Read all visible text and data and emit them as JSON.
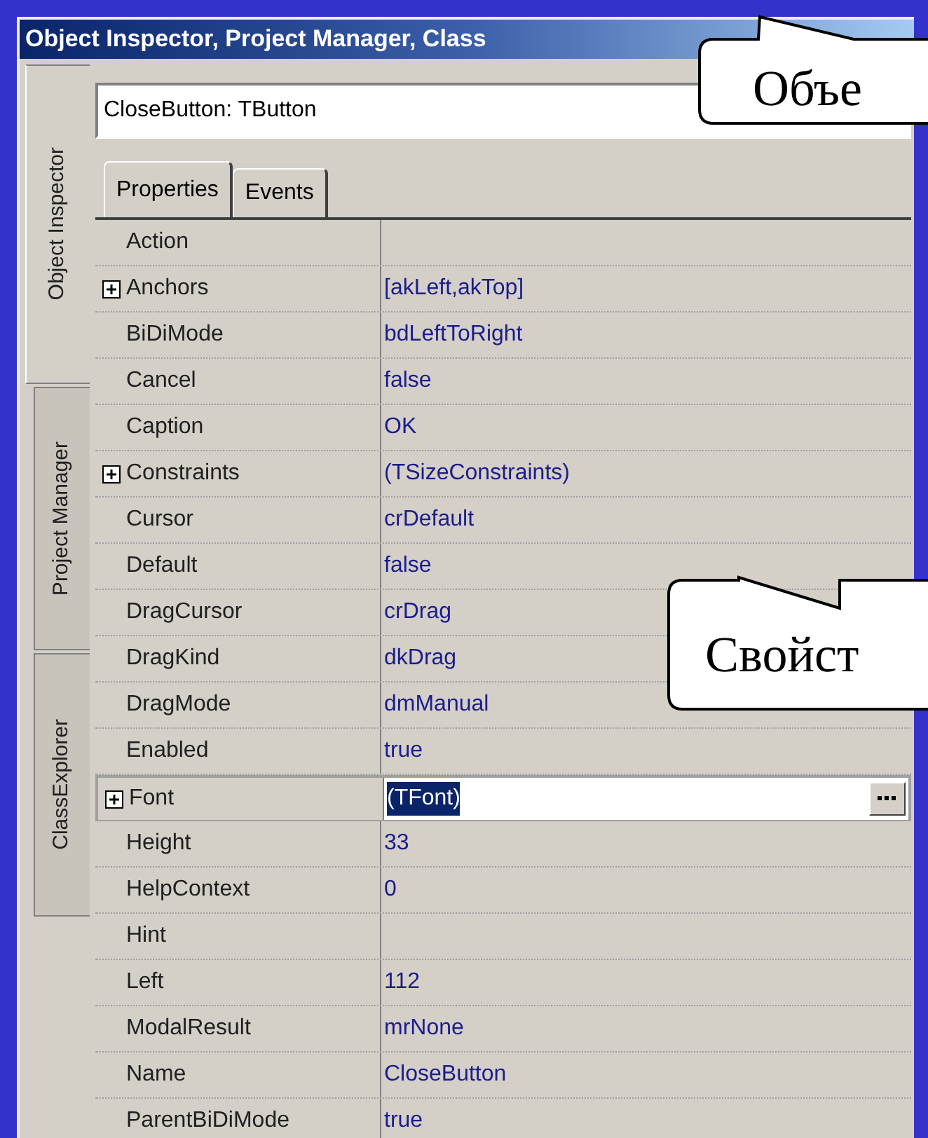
{
  "window": {
    "title": "Object Inspector, Project Manager, Class"
  },
  "side_tabs": [
    {
      "label": "Object Inspector",
      "selected": true
    },
    {
      "label": "Project Manager",
      "selected": false
    },
    {
      "label": "ClassExplorer",
      "selected": false
    }
  ],
  "object_selector": {
    "value": "CloseButton: TButton"
  },
  "tabs": [
    {
      "label": "Properties",
      "selected": true
    },
    {
      "label": "Events",
      "selected": false
    }
  ],
  "properties": [
    {
      "name": "Action",
      "expandable": false,
      "selected": false
    },
    {
      "name": "Anchors",
      "value": "[akLeft,akTop]",
      "expandable": true,
      "selected": false
    },
    {
      "name": "BiDiMode",
      "value": "bdLeftToRight",
      "expandable": false,
      "selected": false
    },
    {
      "name": "Cancel",
      "value": "false",
      "expandable": false,
      "selected": false
    },
    {
      "name": "Caption",
      "value": "OK",
      "expandable": false,
      "selected": false
    },
    {
      "name": "Constraints",
      "value": "(TSizeConstraints)",
      "expandable": true,
      "selected": false
    },
    {
      "name": "Cursor",
      "value": "crDefault",
      "expandable": false,
      "selected": false
    },
    {
      "name": "Default",
      "value": "false",
      "expandable": false,
      "selected": false
    },
    {
      "name": "DragCursor",
      "value": "crDrag",
      "expandable": false,
      "selected": false
    },
    {
      "name": "DragKind",
      "value": "dkDrag",
      "expandable": false,
      "selected": false
    },
    {
      "name": "DragMode",
      "value": "dmManual",
      "expandable": false,
      "selected": false
    },
    {
      "name": "Enabled",
      "value": "true",
      "expandable": false,
      "selected": false
    },
    {
      "name": "Font",
      "value": "(TFont)",
      "expandable": true,
      "selected": true
    },
    {
      "name": "Height",
      "value": "33",
      "expandable": false,
      "selected": false
    },
    {
      "name": "HelpContext",
      "value": "0",
      "expandable": false,
      "selected": false
    },
    {
      "name": "Hint",
      "expandable": false,
      "selected": false
    },
    {
      "name": "Left",
      "value": "112",
      "expandable": false,
      "selected": false
    },
    {
      "name": "ModalResult",
      "value": "mrNone",
      "expandable": false,
      "selected": false
    },
    {
      "name": "Name",
      "value": "CloseButton",
      "expandable": false,
      "selected": false
    },
    {
      "name": "ParentBiDiMode",
      "value": "true",
      "expandable": false,
      "selected": false
    }
  ],
  "callouts": [
    {
      "text": "Объе"
    },
    {
      "text": "Свойст"
    }
  ]
}
